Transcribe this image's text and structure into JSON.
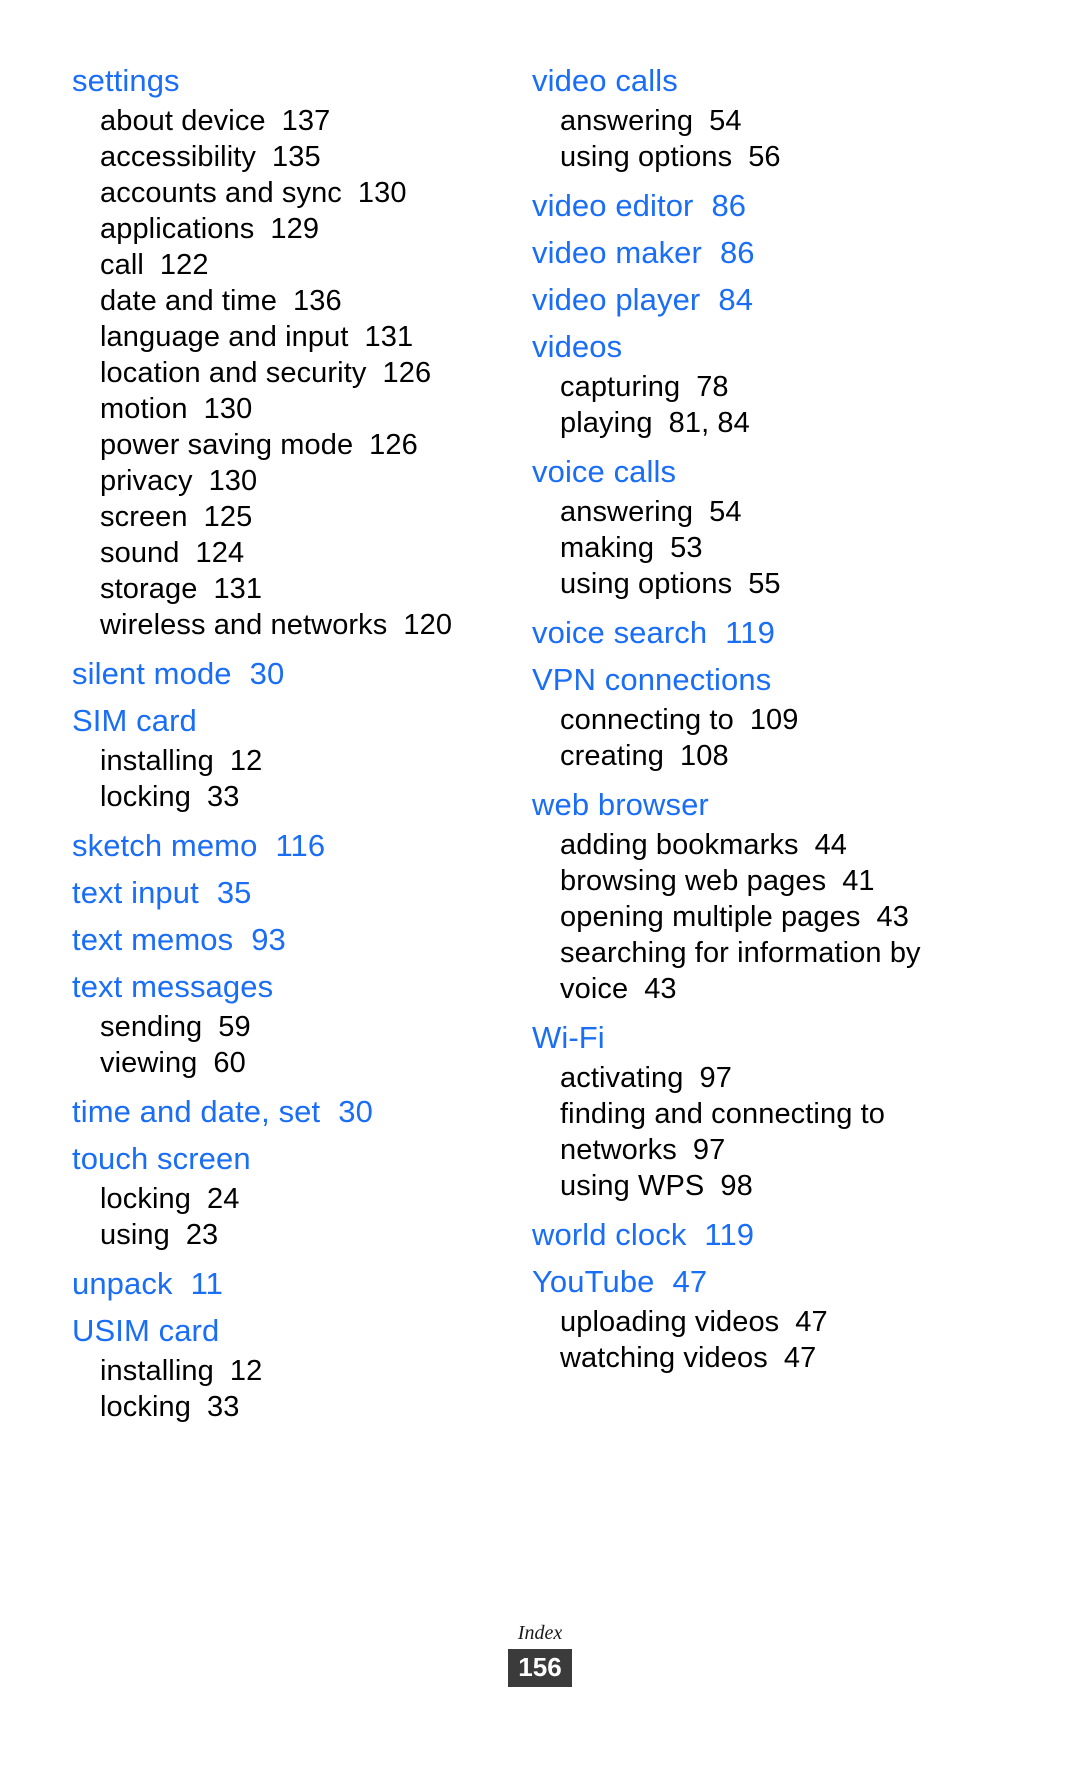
{
  "page": {
    "footer_label": "Index",
    "page_number": "156",
    "accent_color": "#1a6ef5",
    "text_color": "#000000",
    "background_color": "#ffffff"
  },
  "columns": [
    {
      "name": "left-column",
      "groups": [
        {
          "headword": "settings",
          "page": "",
          "subentries": [
            {
              "label": "about device",
              "page": "137"
            },
            {
              "label": "accessibility",
              "page": "135"
            },
            {
              "label": "accounts and sync",
              "page": "130"
            },
            {
              "label": "applications",
              "page": "129"
            },
            {
              "label": "call",
              "page": "122"
            },
            {
              "label": "date and time",
              "page": "136"
            },
            {
              "label": "language and input",
              "page": "131"
            },
            {
              "label": "location and security",
              "page": "126"
            },
            {
              "label": "motion",
              "page": "130"
            },
            {
              "label": "power saving mode",
              "page": "126"
            },
            {
              "label": "privacy",
              "page": "130"
            },
            {
              "label": "screen",
              "page": "125"
            },
            {
              "label": "sound",
              "page": "124"
            },
            {
              "label": "storage",
              "page": "131"
            },
            {
              "label": "wireless and networks",
              "page": "120"
            }
          ]
        },
        {
          "headword": "silent mode",
          "page": "30",
          "subentries": []
        },
        {
          "headword": "SIM card",
          "page": "",
          "subentries": [
            {
              "label": "installing",
              "page": "12"
            },
            {
              "label": "locking",
              "page": "33"
            }
          ]
        },
        {
          "headword": "sketch memo",
          "page": "116",
          "subentries": []
        },
        {
          "headword": "text input",
          "page": "35",
          "subentries": []
        },
        {
          "headword": "text memos",
          "page": "93",
          "subentries": []
        },
        {
          "headword": "text messages",
          "page": "",
          "subentries": [
            {
              "label": "sending",
              "page": "59"
            },
            {
              "label": "viewing",
              "page": "60"
            }
          ]
        },
        {
          "headword": "time and date, set",
          "page": "30",
          "subentries": []
        },
        {
          "headword": "touch screen",
          "page": "",
          "subentries": [
            {
              "label": "locking",
              "page": "24"
            },
            {
              "label": "using",
              "page": "23"
            }
          ]
        },
        {
          "headword": "unpack",
          "page": "11",
          "subentries": []
        },
        {
          "headword": "USIM card",
          "page": "",
          "subentries": [
            {
              "label": "installing",
              "page": "12"
            },
            {
              "label": "locking",
              "page": "33"
            }
          ]
        }
      ]
    },
    {
      "name": "right-column",
      "groups": [
        {
          "headword": "video calls",
          "page": "",
          "subentries": [
            {
              "label": "answering",
              "page": "54"
            },
            {
              "label": "using options",
              "page": "56"
            }
          ]
        },
        {
          "headword": "video editor",
          "page": "86",
          "subentries": []
        },
        {
          "headword": "video maker",
          "page": "86",
          "subentries": []
        },
        {
          "headword": "video player",
          "page": "84",
          "subentries": []
        },
        {
          "headword": "videos",
          "page": "",
          "subentries": [
            {
              "label": "capturing",
              "page": "78"
            },
            {
              "label": "playing",
              "page": "81, 84"
            }
          ]
        },
        {
          "headword": "voice calls",
          "page": "",
          "subentries": [
            {
              "label": "answering",
              "page": "54"
            },
            {
              "label": "making",
              "page": "53"
            },
            {
              "label": "using options",
              "page": "55"
            }
          ]
        },
        {
          "headword": "voice search",
          "page": "119",
          "subentries": []
        },
        {
          "headword": "VPN connections",
          "page": "",
          "subentries": [
            {
              "label": "connecting to",
              "page": "109"
            },
            {
              "label": "creating",
              "page": "108"
            }
          ]
        },
        {
          "headword": "web browser",
          "page": "",
          "subentries": [
            {
              "label": "adding bookmarks",
              "page": "44"
            },
            {
              "label": "browsing web pages",
              "page": "41"
            },
            {
              "label": "opening multiple pages",
              "page": "43"
            },
            {
              "label": "searching for information by voice",
              "page": "43"
            }
          ]
        },
        {
          "headword": "Wi-Fi",
          "page": "",
          "subentries": [
            {
              "label": "activating",
              "page": "97"
            },
            {
              "label": "finding and connecting to networks",
              "page": "97"
            },
            {
              "label": "using WPS",
              "page": "98"
            }
          ]
        },
        {
          "headword": "world clock",
          "page": "119",
          "subentries": []
        },
        {
          "headword": "YouTube",
          "page": "47",
          "subentries": [
            {
              "label": "uploading videos",
              "page": "47"
            },
            {
              "label": "watching videos",
              "page": "47"
            }
          ]
        }
      ]
    }
  ]
}
